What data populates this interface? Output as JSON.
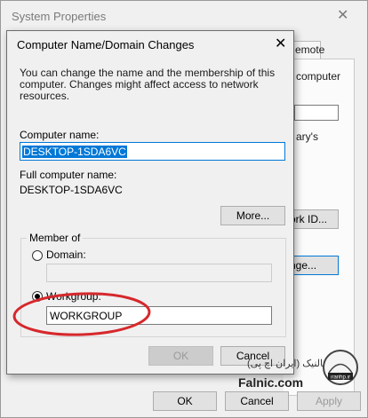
{
  "back_window": {
    "title": "System Properties",
    "tab_fragment": "emote",
    "text_fragment_1": "computer",
    "text_fragment_2": "ary's",
    "network_id_label": "ork ID...",
    "change_label": "nge...",
    "ok_label": "OK",
    "cancel_label": "Cancel",
    "apply_label": "Apply"
  },
  "dialog": {
    "title": "Computer Name/Domain Changes",
    "intro_line1": "You can change the name and the membership of this",
    "intro_line2": "computer. Changes might affect access to network resources.",
    "computer_name_label": "Computer name:",
    "computer_name_value": "DESKTOP-1SDA6VC",
    "full_name_label": "Full computer name:",
    "full_name_value": "DESKTOP-1SDA6VC",
    "more_button": "More...",
    "member_of_label": "Member of",
    "domain_label": "Domain:",
    "domain_value": "",
    "workgroup_label": "Workgroup:",
    "workgroup_value": "WORKGROUP",
    "selected_option": "Workgroup",
    "ok_button": "OK",
    "cancel_button": "Cancel"
  },
  "watermark": {
    "persian_text": "فالنیک (ایران اچ پی)",
    "brand": "Falnic.com",
    "logo_text": "ıranhp.ır"
  },
  "colors": {
    "accent": "#0078d7",
    "annotation": "#d6282c"
  }
}
